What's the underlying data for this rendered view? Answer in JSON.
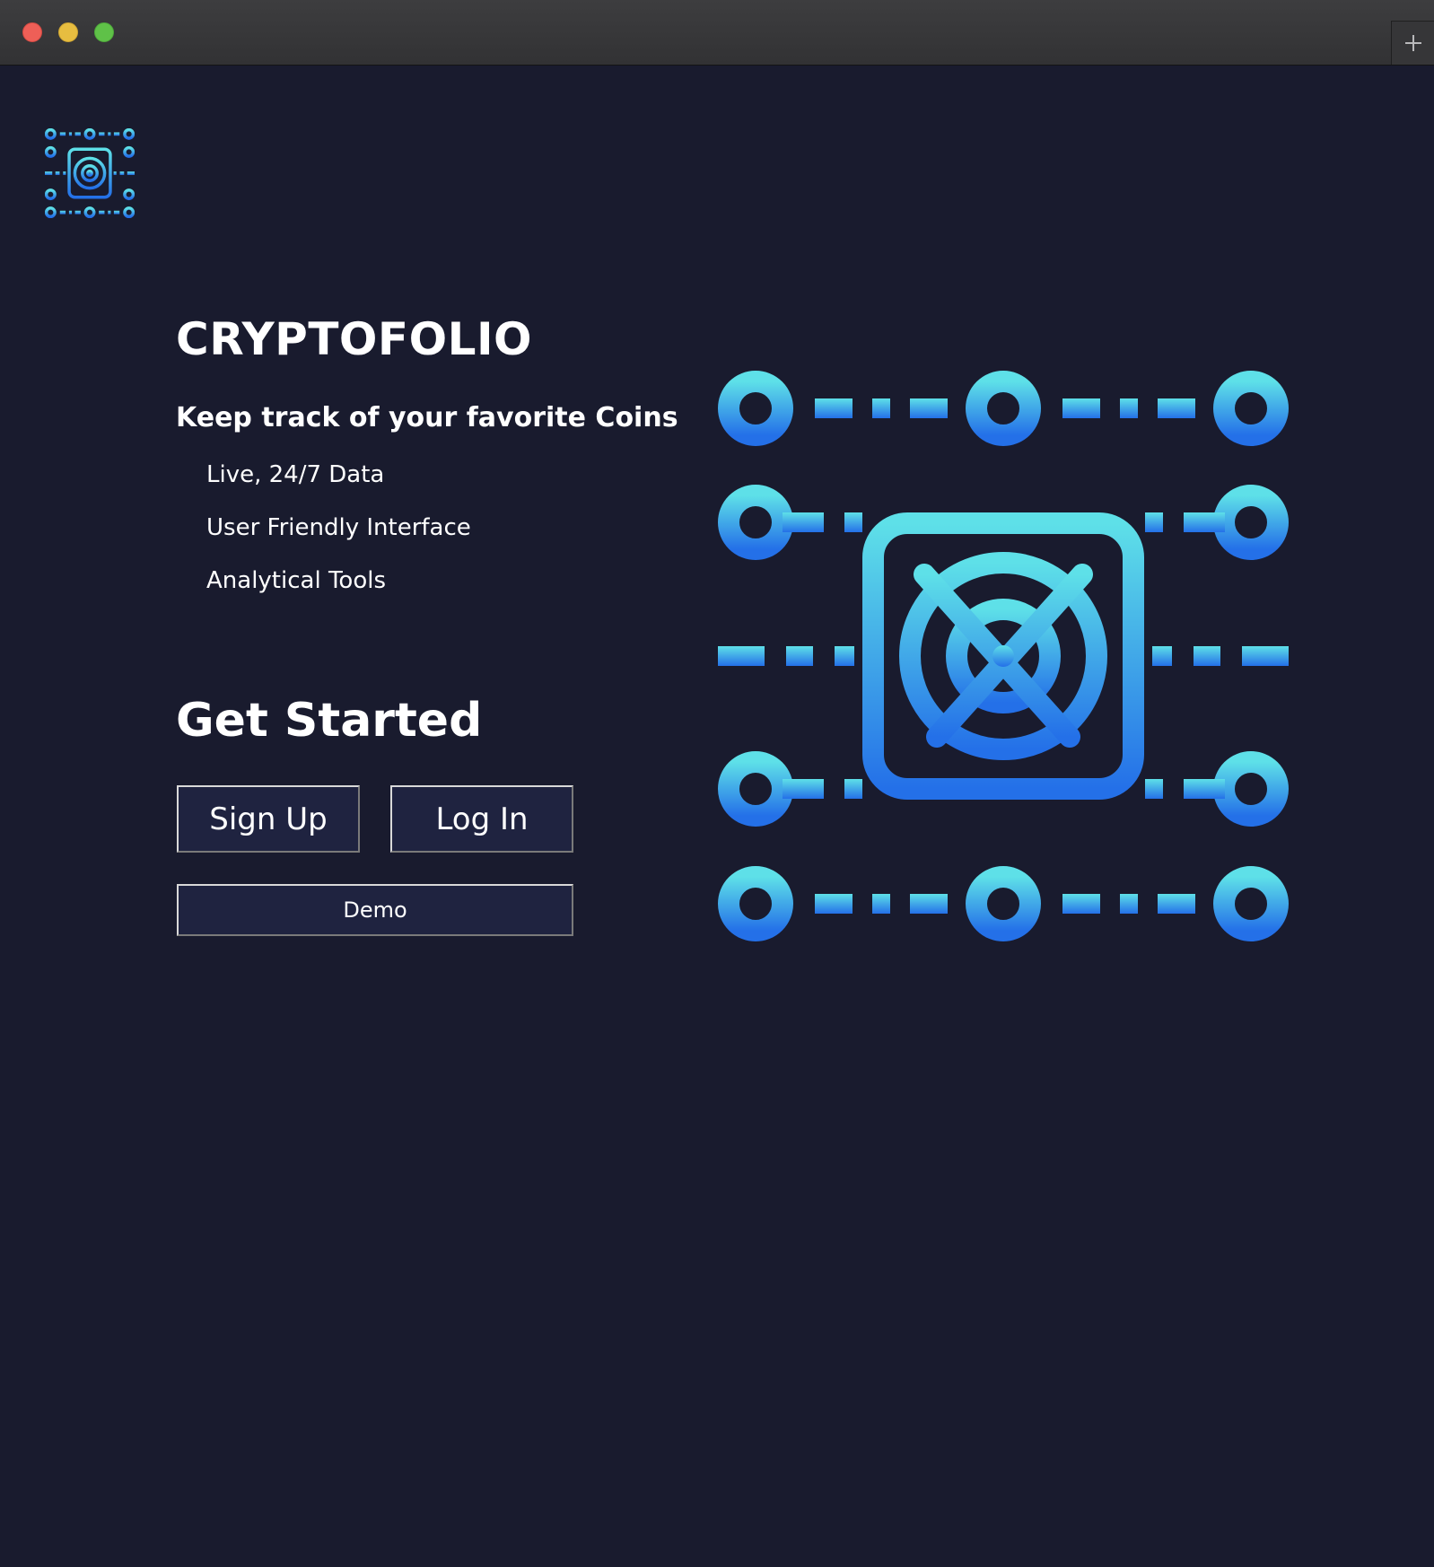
{
  "window": {
    "controls": [
      "close",
      "minimize",
      "zoom"
    ],
    "new_tab_icon": "plus-icon"
  },
  "brand": {
    "logo_icon": "vault-network-icon",
    "title": "CRYPTOFOLIO",
    "tagline": "Keep track of your favorite Coins"
  },
  "features": [
    "Live, 24/7 Data",
    "User Friendly Interface",
    "Analytical Tools"
  ],
  "get_started": {
    "heading": "Get Started",
    "signup_label": "Sign Up",
    "login_label": "Log In",
    "demo_label": "Demo"
  },
  "hero": {
    "icon": "vault-network-icon"
  },
  "colors": {
    "background": "#191b2e",
    "button_bg": "#1f2340",
    "gradient_top": "#5ee0e8",
    "gradient_bottom": "#2470e8"
  }
}
